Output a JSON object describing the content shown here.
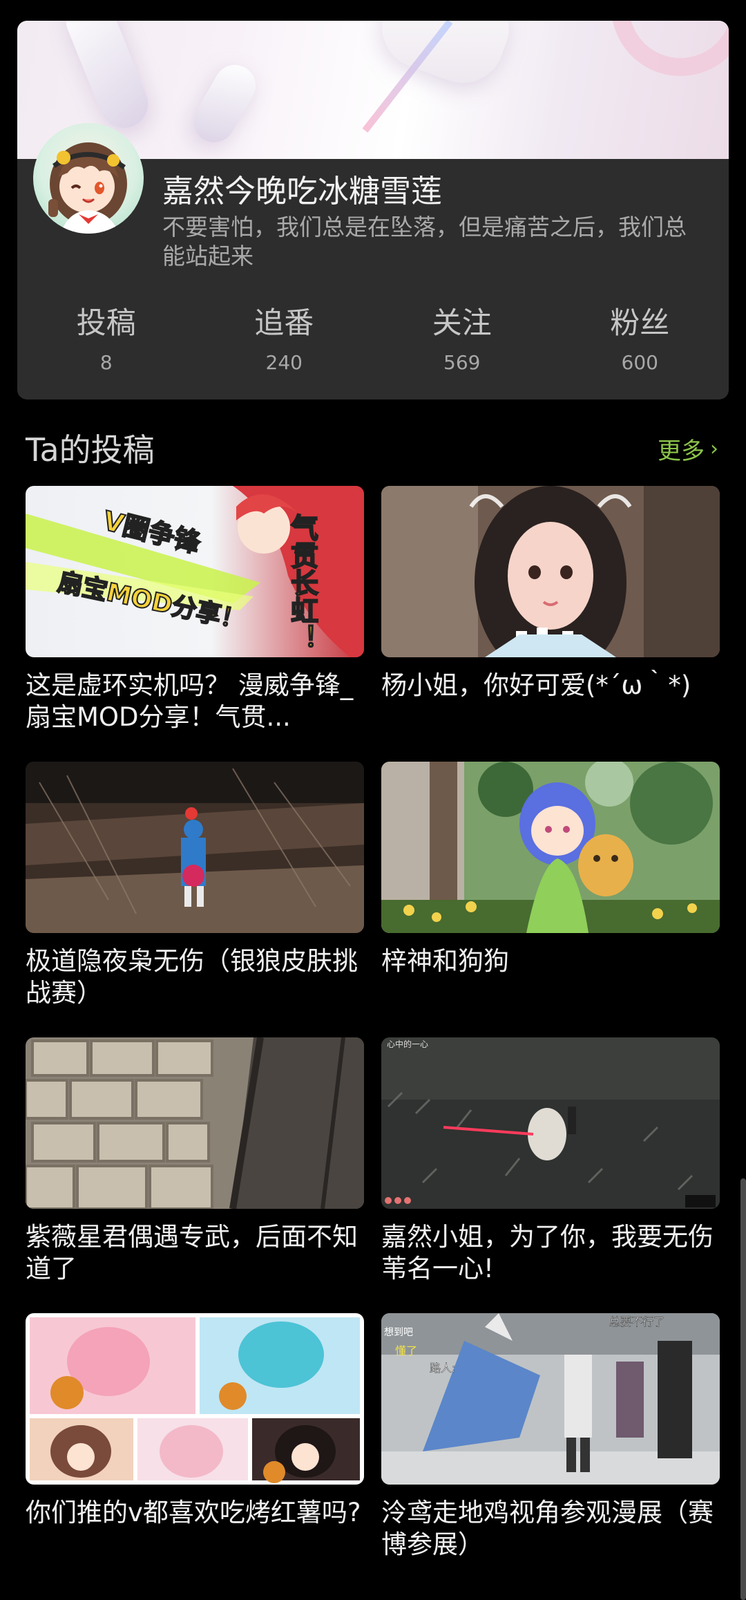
{
  "profile": {
    "username": "嘉然今晚吃冰糖雪莲",
    "bio": "不要害怕，我们总是在坠落，但是痛苦之后，我们总能站起来",
    "stats": [
      {
        "label": "投稿",
        "value": "8"
      },
      {
        "label": "追番",
        "value": "240"
      },
      {
        "label": "关注",
        "value": "569"
      },
      {
        "label": "粉丝",
        "value": "600"
      }
    ]
  },
  "section": {
    "title": "Ta的投稿",
    "more_label": "更多",
    "more_icon": "chevron-right-icon"
  },
  "videos": [
    {
      "title": "这是虚环实机吗？ 漫威争锋_扇宝MOD分享！气贯...",
      "thumb_text": [
        "V圈争锋",
        "扇宝MOD分享！",
        "气贯长虹！"
      ]
    },
    {
      "title": "杨小姐，你好可爱(*´ω｀*)"
    },
    {
      "title": "极道隐夜枭无伤（银狼皮肤挑战赛）"
    },
    {
      "title": "梓神和狗狗"
    },
    {
      "title": "紫薇星君偶遇专武，后面不知道了"
    },
    {
      "title": "嘉然小姐，为了你，我要无伤苇名一心!",
      "thumb_text": [
        "心中的一心"
      ]
    },
    {
      "title": "你们推的v都喜欢吃烤红薯吗?"
    },
    {
      "title": "泠鸢走地鸡视角参观漫展（赛博参展）",
      "thumb_text": [
        "总要不行了",
        "想到吧",
        "懂了",
        "路人:"
      ]
    }
  ],
  "colors": {
    "background": "#000000",
    "card": "#2d2d2d",
    "accent": "#8bc34a"
  }
}
